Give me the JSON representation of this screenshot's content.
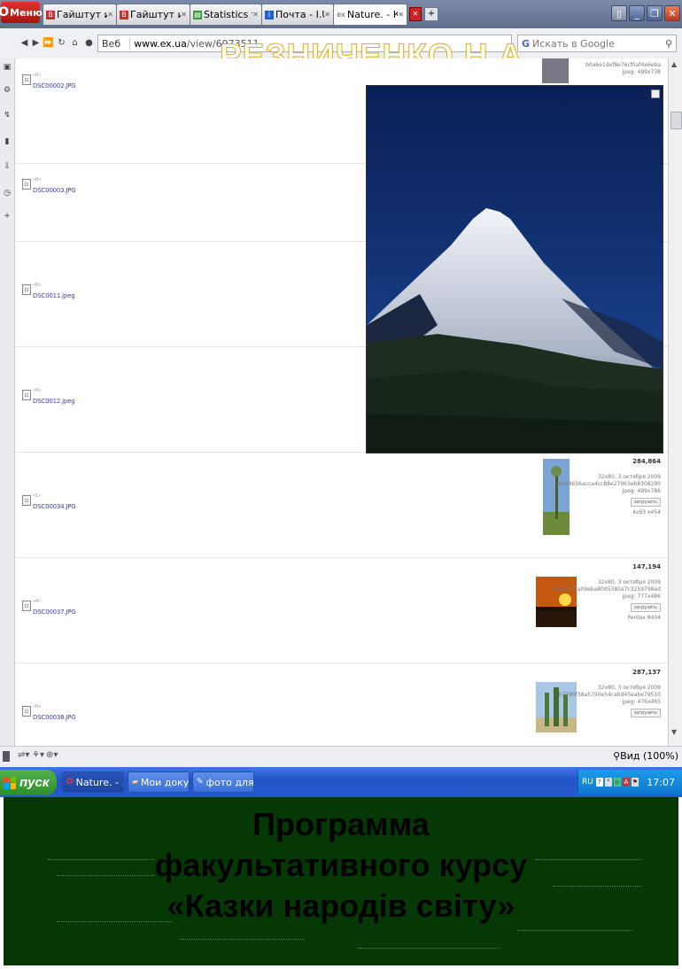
{
  "browser": {
    "menu_label": "Меню",
    "tabs": [
      {
        "label": "Гайштут и е...",
        "icon": "vk-icon",
        "color": "#d52b2b"
      },
      {
        "label": "Гайштут и е...",
        "icon": "vk-icon",
        "color": "#d52b2b"
      },
      {
        "label": "Statistics for...",
        "icon": "stats-icon",
        "color": "#3a9a3a"
      },
      {
        "label": "Почта - I.UA",
        "icon": "iua-icon",
        "color": "#1f5fd0"
      },
      {
        "label": "Nature. - Кл...",
        "icon": "ex-icon",
        "color": "#555555",
        "active": true
      }
    ],
    "nav": {
      "search_engine": "Веб",
      "address_host": "www.ex.ua",
      "address_path": "/view/6973511",
      "google_placeholder": "Искать в Google"
    },
    "watermark": "РЕЗНИЧЕНКО Н.А",
    "zoom_label": "Вид (100%)"
  },
  "files": [
    {
      "counter": "«0»",
      "name": "DSC00002.JPG"
    },
    {
      "counter": "«0»",
      "name": "DSC00003.JPG"
    },
    {
      "counter": "«0»",
      "name": "DSC0011.jpeg"
    },
    {
      "counter": "«0»",
      "name": "DSC0012.jpeg"
    },
    {
      "counter": "«1»",
      "name": "DSC00034.JPG",
      "meta": {
        "size": "284,864",
        "line1": "32x80, 3 октября 2009",
        "line2": "81a8656acca4cc88e27963eb8308290",
        "line3": "jpeg: 499x786",
        "button": "загрузить",
        "line4": "4x63 x454"
      }
    },
    {
      "counter": "«0»",
      "name": "DSC00037.JPG",
      "meta": {
        "size": "147,194",
        "line1": "32x80, 3 октября 2009",
        "line2": "e6eed7f2a09eba80d5380a7c3259798ed",
        "line3": "jpeg: 777x486",
        "button": "загрузить",
        "line4": "Pentax 8404"
      }
    },
    {
      "counter": "«0»",
      "name": "DSC00038.JPG",
      "meta": {
        "size": "287,137",
        "line1": "32x80, 3 октября 2009",
        "line2": "b77d0f38a5790e54cabd45eabe79510",
        "line3": "jpeg: 476x465",
        "button": "загрузить"
      }
    }
  ],
  "top_meta": {
    "line1": "b0a6e1def8e76cf0af4e6eba",
    "line2": "jpeg: 499x738"
  },
  "taskbar": {
    "start_label": "пуск",
    "buttons": [
      {
        "label": "Nature. - ...",
        "icon": "opera-icon",
        "active": true
      },
      {
        "label": "Мои доку...",
        "icon": "folder-icon"
      },
      {
        "label": "фото для ...",
        "icon": "paint-icon"
      }
    ],
    "tray_lang": "RU",
    "clock": "17:07"
  },
  "slide": {
    "line1": "Программа",
    "line2": "факультативного курсу",
    "line3": "«Казки народів світу»"
  },
  "colors": {
    "slide_bg": "#063806",
    "taskbar_blue": "#245ad0",
    "start_green": "#3fa03d",
    "opera_red": "#d52b2b"
  }
}
